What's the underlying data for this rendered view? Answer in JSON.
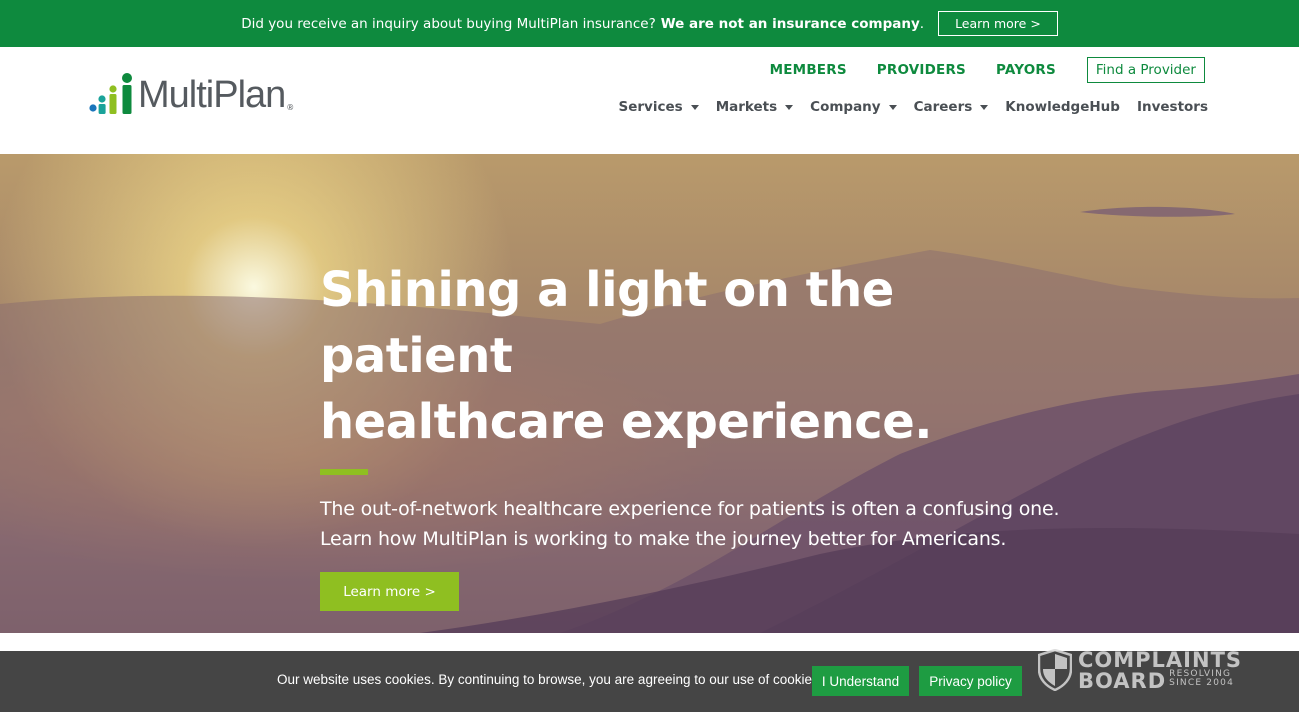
{
  "alert_bar": {
    "message": "Did you receive an inquiry about buying MultiPlan insurance?",
    "emphasis": "We are not an insurance company",
    "period": ".",
    "button_label": "Learn more >"
  },
  "brand": {
    "name": "MultiPlan",
    "registered": "®",
    "colors": {
      "green": "#0e8a3e",
      "lime": "#8fbf21",
      "blue": "#1a75bb",
      "teal": "#1aa39a",
      "gray": "#555a5f"
    }
  },
  "top_links": [
    "MEMBERS",
    "PROVIDERS",
    "PAYORS"
  ],
  "find_provider_label": "Find a Provider",
  "main_nav": [
    {
      "label": "Services",
      "dropdown": true
    },
    {
      "label": "Markets",
      "dropdown": true
    },
    {
      "label": "Company",
      "dropdown": true
    },
    {
      "label": "Careers",
      "dropdown": true
    },
    {
      "label": "KnowledgeHub",
      "dropdown": false
    },
    {
      "label": "Investors",
      "dropdown": false
    }
  ],
  "hero": {
    "title_line1": "Shining a light on the patient",
    "title_line2": "healthcare experience.",
    "sub_line1": "The out-of-network healthcare experience for patients is often a confusing one.",
    "sub_line2": "Learn how MultiPlan is working to make the journey better for Americans.",
    "button_label": "Learn more >"
  },
  "cookie_bar": {
    "text": "Our website uses cookies. By continuing to browse, you are agreeing to our use of cookies.",
    "understand_label": "I Understand",
    "privacy_label": "Privacy policy"
  },
  "complaints_board": {
    "word1": "COMPLAINTS",
    "word2": "BOARD",
    "tag1": "RESOLVING",
    "tag2": "SINCE 2004"
  }
}
